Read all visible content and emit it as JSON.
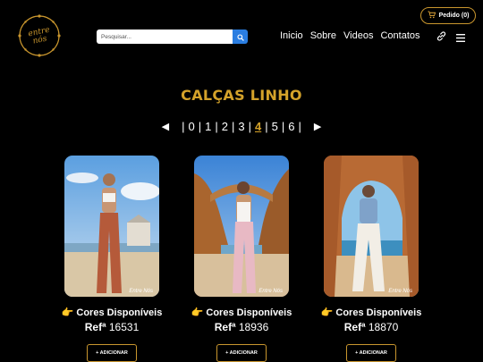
{
  "header": {
    "cart_label": "Pedido (0)",
    "logo_text": "entre nós",
    "search": {
      "placeholder": "Pesquisar..."
    },
    "nav": [
      "Inicio",
      "Sobre",
      "Videos",
      "Contatos"
    ],
    "icons": {
      "cart": "cart-icon",
      "search": "search-icon",
      "link": "link-icon",
      "menu": "hamburger-menu-icon"
    }
  },
  "main": {
    "title": "CALÇAS LINHO",
    "pager": {
      "prev": "◀",
      "next": "▶",
      "pages": [
        "0",
        "1",
        "2",
        "3",
        "4",
        "5",
        "6"
      ],
      "active": "4"
    },
    "products": [
      {
        "colors_label": "👉 Cores Disponíveis",
        "ref_prefix": "Refª",
        "ref_code": "16531",
        "add_label": "+ ADICIONAR",
        "watermark": "Entre Nós",
        "pants_color": "#b55a3a"
      },
      {
        "colors_label": "👉 Cores Disponíveis",
        "ref_prefix": "Refª",
        "ref_code": "18936",
        "add_label": "+ ADICIONAR",
        "watermark": "Entre Nós",
        "pants_color": "#e8b9c4"
      },
      {
        "colors_label": "👉 Cores Disponíveis",
        "ref_prefix": "Refª",
        "ref_code": "18870",
        "add_label": "+ ADICIONAR",
        "watermark": "Entre Nós",
        "pants_color": "#f2eee6"
      }
    ]
  },
  "colors": {
    "accent": "#d4a22a",
    "border": "#c9962e",
    "search_button": "#2a7de1",
    "background": "#000000"
  }
}
